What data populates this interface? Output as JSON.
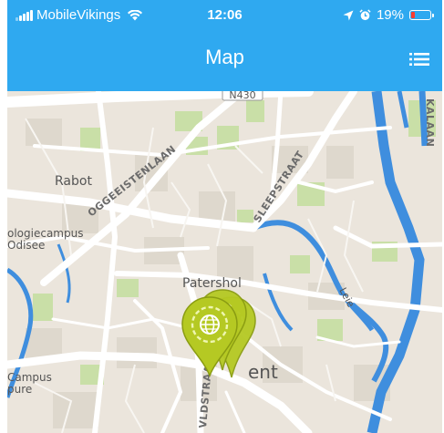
{
  "status_bar": {
    "carrier": "MobileVikings",
    "time": "12:06",
    "battery_percent": "19%",
    "battery_level": 0.19,
    "signal_bars": 5,
    "signal_bars_active": 3
  },
  "nav": {
    "title": "Map",
    "menu_icon": "hamburger-list-icon"
  },
  "map": {
    "road_shield": "N430",
    "places": {
      "rabot": "Rabot",
      "logiecampus_line1": "ologiecampus",
      "logiecampus_line2": "Odisee",
      "patershol": "Patershol",
      "campus_line1": "Campus",
      "campus_line2": "pure",
      "gent_partial": "ent"
    },
    "streets": {
      "ogeeistenlaan": "OGGEEISTENLAAN",
      "sleepstraat": "SLEEPSTRAAT",
      "vldstraat": "VLDSTRAAT",
      "kalaan": "KALAAN"
    },
    "water": {
      "leie": "Leie"
    },
    "markers": [
      {
        "name": "location-marker-1",
        "icon": "globe-icon"
      },
      {
        "name": "location-marker-2",
        "icon": "globe-icon"
      },
      {
        "name": "location-marker-3",
        "icon": "globe-icon"
      }
    ]
  },
  "colors": {
    "header": "#2fa9f0",
    "battery_low": "#ff3b30",
    "marker_fill": "#b5c923",
    "marker_stroke": "#8a9c12",
    "water": "#3f8ede",
    "park": "#c9dfa7",
    "road": "#ffffff",
    "map_bg": "#ebe5dc"
  }
}
